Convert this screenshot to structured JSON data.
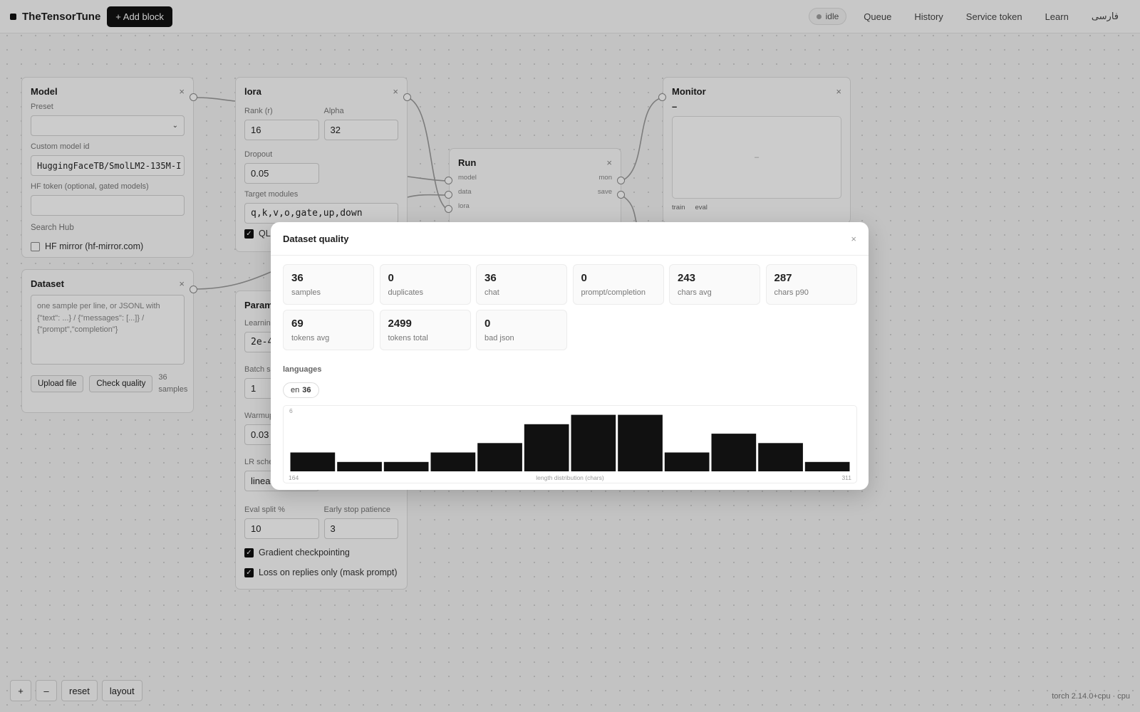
{
  "app": {
    "name": "TheTensorTune",
    "add_block": "+  Add block"
  },
  "nav": {
    "status": "idle",
    "items": [
      "Queue",
      "History",
      "Service token",
      "Learn",
      "فارسی"
    ]
  },
  "model_node": {
    "title": "Model",
    "preset_label": "Preset",
    "custom_label": "Custom model id",
    "custom_value": "HuggingFaceTB/SmolLM2-135M-I",
    "token_label": "HF token (optional, gated models)",
    "search_hub": "Search Hub",
    "mirror_label": "HF mirror (hf-mirror.com)"
  },
  "dataset_node": {
    "title": "Dataset",
    "placeholder": "one sample per line, or JSONL with {\"text\": ...} / {\"messages\": [...]} / {\"prompt\",\"completion\"}",
    "upload": "Upload file",
    "check": "Check quality",
    "count": "36 samples"
  },
  "lora_node": {
    "title": "lora",
    "rank_label": "Rank (r)",
    "rank_value": "16",
    "alpha_label": "Alpha",
    "alpha_value": "32",
    "dropout_label": "Dropout",
    "dropout_value": "0.05",
    "target_label": "Target modules",
    "target_value": "q,k,v,o,gate,up,down",
    "qlora": "QL"
  },
  "params_node": {
    "title": "Param",
    "lr_label": "Learnin",
    "lr_value": "2e-4",
    "batch_label": "Batch s",
    "batch_value": "1",
    "warmup_label": "Warmup",
    "warmup_value": "0.03",
    "sched_label": "LR sche",
    "sched_value": "linea",
    "eval_label": "Eval split %",
    "eval_value": "10",
    "patience_label": "Early stop patience",
    "patience_value": "3",
    "grad_ckpt": "Gradient checkpointing",
    "loss_replies": "Loss on replies only (mask prompt)"
  },
  "run_node": {
    "title": "Run",
    "inputs": [
      "model",
      "data",
      "lora"
    ],
    "outputs": [
      "mon",
      "save"
    ]
  },
  "monitor_node": {
    "title": "Monitor",
    "value": "–",
    "placeholder": "–",
    "tabs": [
      "train",
      "eval"
    ]
  },
  "modal": {
    "title": "Dataset quality",
    "stats": [
      {
        "value": "36",
        "label": "samples"
      },
      {
        "value": "0",
        "label": "duplicates"
      },
      {
        "value": "36",
        "label": "chat"
      },
      {
        "value": "0",
        "label": "prompt/completion"
      },
      {
        "value": "243",
        "label": "chars avg"
      },
      {
        "value": "287",
        "label": "chars p90"
      },
      {
        "value": "69",
        "label": "tokens avg"
      },
      {
        "value": "2499",
        "label": "tokens total"
      },
      {
        "value": "0",
        "label": "bad json"
      }
    ],
    "languages_label": "languages",
    "language": {
      "code": "en",
      "count": "36"
    }
  },
  "chart_data": {
    "type": "bar",
    "xlabel": "length distribution (chars)",
    "x_min_label": "164",
    "x_max_label": "311",
    "y_max_label": "6",
    "ylim": [
      0,
      6.5
    ],
    "values": [
      2,
      1,
      1,
      2,
      3,
      5,
      6,
      6,
      2,
      4,
      3,
      1
    ]
  },
  "controls": {
    "zoom_in": "+",
    "zoom_out": "–",
    "reset": "reset",
    "layout": "layout"
  },
  "footer": "torch 2.14.0+cpu · cpu"
}
